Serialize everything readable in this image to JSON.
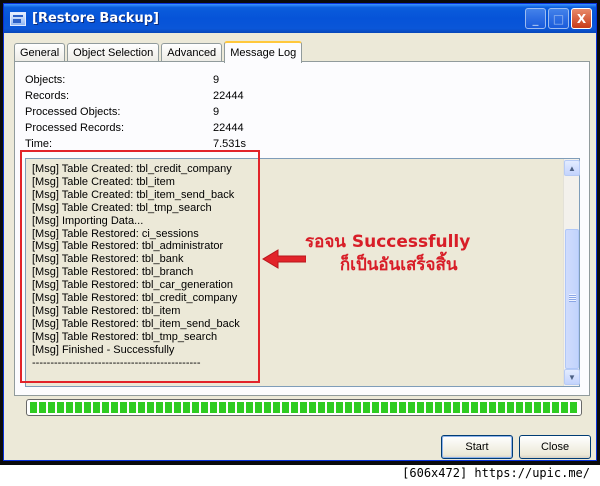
{
  "window": {
    "title": "[Restore Backup]",
    "buttons": {
      "minimize": "_",
      "maximize": "□",
      "close": "X"
    }
  },
  "tabs": [
    "General",
    "Object Selection",
    "Advanced",
    "Message Log"
  ],
  "active_tab": "Message Log",
  "stats": [
    {
      "label": "Objects:",
      "value": "9"
    },
    {
      "label": "Records:",
      "value": "22444"
    },
    {
      "label": "Processed Objects:",
      "value": "9"
    },
    {
      "label": "Processed Records:",
      "value": "22444"
    },
    {
      "label": "Time:",
      "value": "7.531s"
    }
  ],
  "log_lines": [
    "[Msg] Table Created: tbl_credit_company",
    "[Msg] Table Created: tbl_item",
    "[Msg] Table Created: tbl_item_send_back",
    "[Msg] Table Created: tbl_tmp_search",
    "[Msg] Importing Data...",
    "[Msg] Table Restored: ci_sessions",
    "[Msg] Table Restored: tbl_administrator",
    "[Msg] Table Restored: tbl_bank",
    "[Msg] Table Restored: tbl_branch",
    "[Msg] Table Restored: tbl_car_generation",
    "[Msg] Table Restored: tbl_credit_company",
    "[Msg] Table Restored: tbl_item",
    "[Msg] Table Restored: tbl_item_send_back",
    "[Msg] Table Restored: tbl_tmp_search",
    "[Msg] Finished - Successfully",
    "----------------------------------------------"
  ],
  "annotation": {
    "line1": "รอจน Successfully",
    "line2": "ก็เป็นอันเสร็จสิ้น",
    "color": "#d81e28"
  },
  "progress": {
    "percent": 100,
    "color": "#2fcc22"
  },
  "buttons": {
    "start": "Start",
    "close": "Close"
  },
  "watermark": "[606x472] https://upic.me/"
}
